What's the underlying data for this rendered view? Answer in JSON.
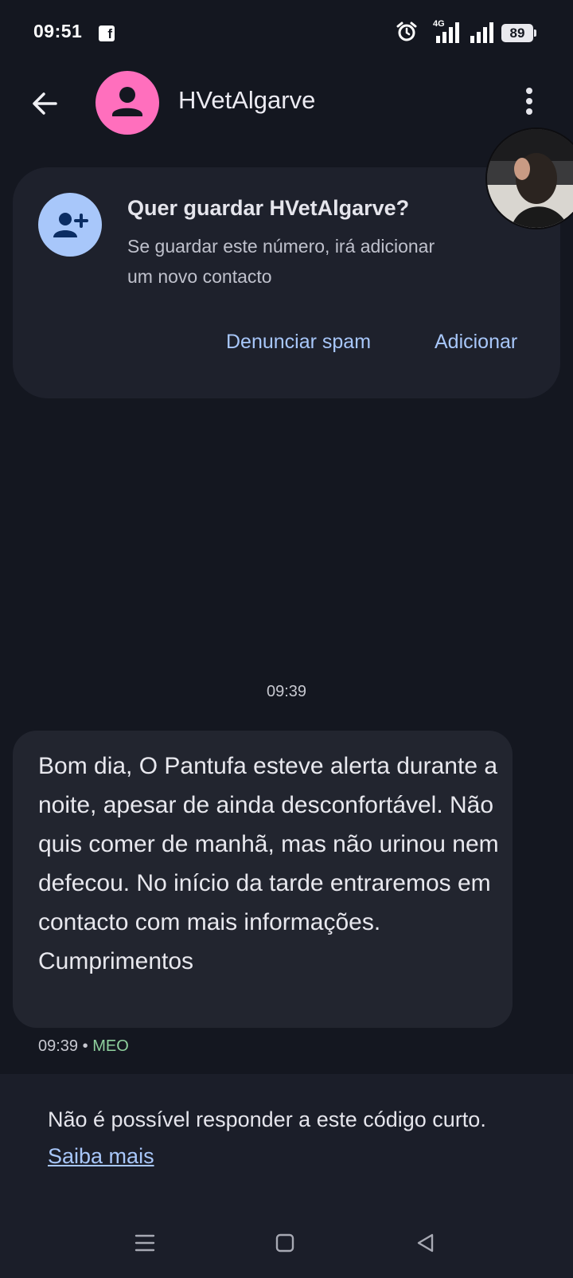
{
  "status_bar": {
    "time": "09:51",
    "network": "4G",
    "battery": "89"
  },
  "header": {
    "contact_name": "HVetAlgarve"
  },
  "save_card": {
    "title": "Quer guardar HVetAlgarve?",
    "description": "Se guardar este número, irá adicionar um novo contacto",
    "spam_label": "Denunciar spam",
    "add_label": "Adicionar"
  },
  "conversation": {
    "time_separator": "09:39",
    "message": {
      "text": "Bom dia, O Pantufa esteve alerta durante a noite, apesar de ainda desconfortável. Não quis comer de manhã, mas não urinou nem defecou. No início da tarde entraremos em contacto com mais informações. Cumprimentos",
      "time": "09:39",
      "separator": "•",
      "carrier": "MEO"
    }
  },
  "info_panel": {
    "text": "Não é possível responder a este código curto.",
    "link": "Saiba mais"
  },
  "colors": {
    "background": "#141720",
    "card": "#1e212c",
    "accent": "#a8c7fa",
    "avatar": "#ff6fbd",
    "carrier": "#8fd19e"
  }
}
